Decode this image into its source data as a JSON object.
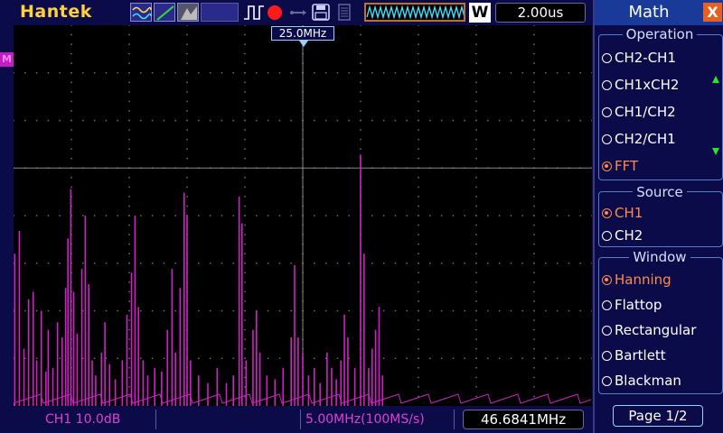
{
  "brand": "Hantek",
  "toolbar": {
    "icons": [
      "math-wave-icon",
      "slope-icon",
      "gray-icon",
      "pulse-icon",
      "record-icon",
      "usb-icon",
      "save-icon",
      "disk-icon",
      "waveform-icon"
    ],
    "mode_letter": "W",
    "timebase": "2.00us"
  },
  "screen": {
    "freq_marker": "25.0MHz",
    "left_marker": "M"
  },
  "spectrum": {
    "color": "#d020c8",
    "peaks": [
      [
        0.002,
        0.4
      ],
      [
        0.01,
        0.46
      ],
      [
        0.018,
        0.15
      ],
      [
        0.026,
        0.28
      ],
      [
        0.034,
        0.3
      ],
      [
        0.04,
        0.12
      ],
      [
        0.048,
        0.25
      ],
      [
        0.056,
        0.09
      ],
      [
        0.06,
        0.2
      ],
      [
        0.068,
        0.1
      ],
      [
        0.076,
        0.22
      ],
      [
        0.084,
        0.18
      ],
      [
        0.09,
        0.31
      ],
      [
        0.094,
        0.44
      ],
      [
        0.099,
        0.57
      ],
      [
        0.104,
        0.3
      ],
      [
        0.11,
        0.19
      ],
      [
        0.118,
        0.36
      ],
      [
        0.124,
        0.5
      ],
      [
        0.13,
        0.32
      ],
      [
        0.136,
        0.12
      ],
      [
        0.142,
        0.08
      ],
      [
        0.152,
        0.14
      ],
      [
        0.158,
        0.22
      ],
      [
        0.166,
        0.11
      ],
      [
        0.176,
        0.07
      ],
      [
        0.188,
        0.12
      ],
      [
        0.196,
        0.24
      ],
      [
        0.204,
        0.35
      ],
      [
        0.21,
        0.5
      ],
      [
        0.216,
        0.26
      ],
      [
        0.224,
        0.12
      ],
      [
        0.232,
        0.08
      ],
      [
        0.244,
        0.1
      ],
      [
        0.256,
        0.09
      ],
      [
        0.266,
        0.2
      ],
      [
        0.274,
        0.36
      ],
      [
        0.28,
        0.14
      ],
      [
        0.288,
        0.31
      ],
      [
        0.295,
        0.56
      ],
      [
        0.3,
        0.5
      ],
      [
        0.306,
        0.12
      ],
      [
        0.32,
        0.08
      ],
      [
        0.336,
        0.06
      ],
      [
        0.352,
        0.1
      ],
      [
        0.368,
        0.06
      ],
      [
        0.38,
        0.08
      ],
      [
        0.39,
        0.55
      ],
      [
        0.395,
        0.48
      ],
      [
        0.402,
        0.12
      ],
      [
        0.414,
        0.2
      ],
      [
        0.42,
        0.25
      ],
      [
        0.426,
        0.14
      ],
      [
        0.438,
        0.08
      ],
      [
        0.452,
        0.07
      ],
      [
        0.466,
        0.1
      ],
      [
        0.48,
        0.18
      ],
      [
        0.486,
        0.37
      ],
      [
        0.492,
        0.18
      ],
      [
        0.5,
        0.14
      ],
      [
        0.51,
        0.08
      ],
      [
        0.52,
        0.1
      ],
      [
        0.53,
        0.06
      ],
      [
        0.542,
        0.14
      ],
      [
        0.55,
        0.1
      ],
      [
        0.558,
        0.07
      ],
      [
        0.566,
        0.12
      ],
      [
        0.572,
        0.24
      ],
      [
        0.578,
        0.18
      ],
      [
        0.59,
        0.1
      ],
      [
        0.6,
        0.66
      ],
      [
        0.606,
        0.4
      ],
      [
        0.614,
        0.1
      ],
      [
        0.62,
        0.15
      ],
      [
        0.626,
        0.2
      ],
      [
        0.632,
        0.26
      ],
      [
        0.638,
        0.08
      ]
    ]
  },
  "status": {
    "ch1_scale": "CH1 10.0dB",
    "sample_rate": "5.00MHz(100MS/s)",
    "cursor_freq": "46.6841MHz"
  },
  "menu": {
    "title": "Math",
    "close_glyph": "X",
    "operation": {
      "title": "Operation",
      "options": [
        "CH2-CH1",
        "CH1xCH2",
        "CH1/CH2",
        "CH2/CH1",
        "FFT"
      ],
      "selected": "FFT"
    },
    "source": {
      "title": "Source",
      "options": [
        "CH1",
        "CH2"
      ],
      "selected": "CH1"
    },
    "window": {
      "title": "Window",
      "options": [
        "Hanning",
        "Flattop",
        "Rectangular",
        "Bartlett",
        "Blackman"
      ],
      "selected": "Hanning"
    },
    "page": "Page 1/2"
  }
}
